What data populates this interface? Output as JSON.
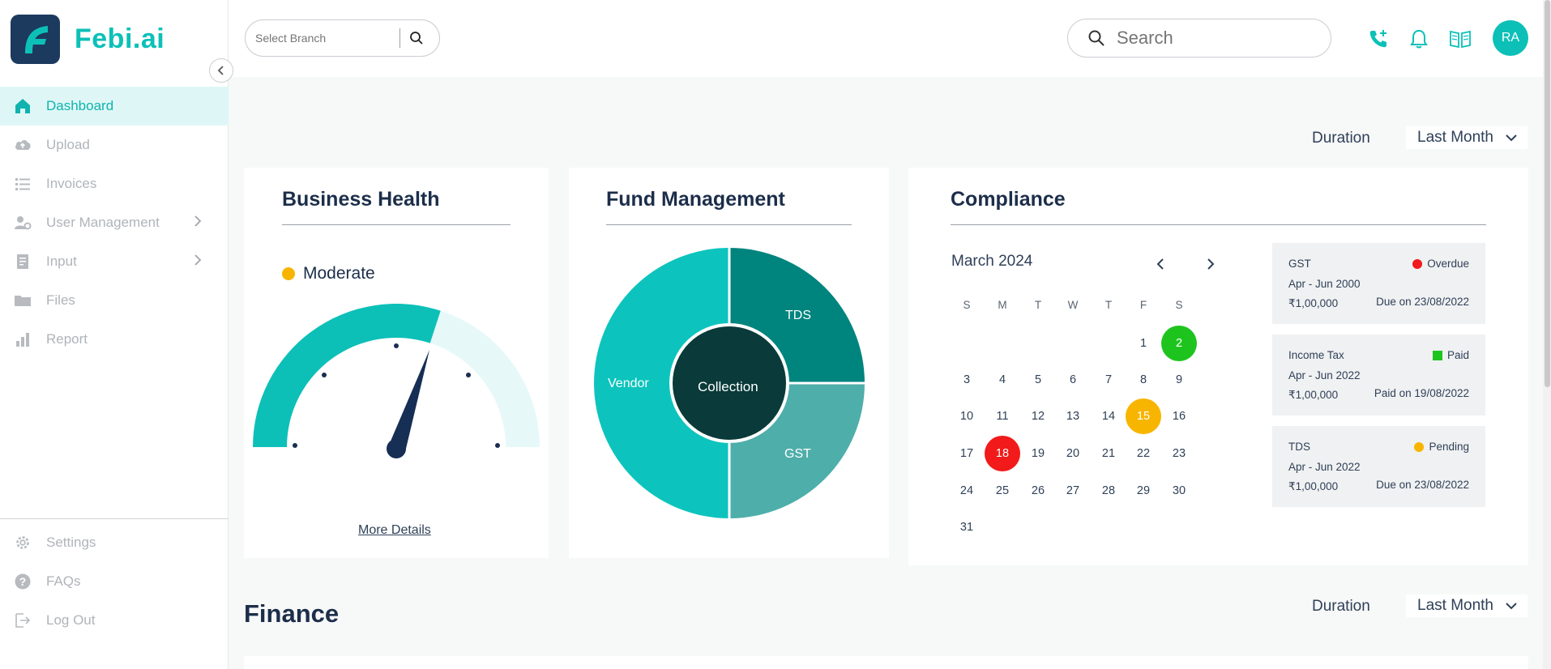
{
  "app": {
    "name": "Febi.ai"
  },
  "sidebar": {
    "items": [
      {
        "label": "Dashboard",
        "icon": "home-icon",
        "active": true
      },
      {
        "label": "Upload",
        "icon": "cloud-upload-icon"
      },
      {
        "label": "Invoices",
        "icon": "list-icon"
      },
      {
        "label": "User Management",
        "icon": "user-settings-icon",
        "submenu": true
      },
      {
        "label": "Input",
        "icon": "document-icon",
        "submenu": true
      },
      {
        "label": "Files",
        "icon": "folder-icon"
      },
      {
        "label": "Report",
        "icon": "bar-chart-icon"
      }
    ],
    "bottom": [
      {
        "label": "Settings",
        "icon": "gear-icon"
      },
      {
        "label": "FAQs",
        "icon": "question-icon"
      },
      {
        "label": "Log Out",
        "icon": "logout-icon"
      }
    ]
  },
  "header": {
    "branch_placeholder": "Select Branch",
    "search_placeholder": "Search",
    "avatar_initials": "RA"
  },
  "filters": {
    "duration_label": "Duration",
    "duration_value": "Last Month"
  },
  "business_health": {
    "title": "Business Health",
    "status": "Moderate",
    "status_color": "#f7b500",
    "link": "More Details"
  },
  "fund_management": {
    "title": "Fund Management",
    "center_label": "Collection",
    "segments": [
      "Vendor",
      "TDS",
      "GST"
    ]
  },
  "compliance": {
    "title": "Compliance",
    "month": "March 2024",
    "weekdays": [
      "S",
      "M",
      "T",
      "W",
      "T",
      "F",
      "S"
    ],
    "highlights": {
      "2": "green",
      "15": "yellow",
      "18": "red"
    },
    "items": [
      {
        "name": "GST",
        "status": "Overdue",
        "status_color": "#f21a1a",
        "period": "Apr - Jun 2000",
        "amount": "₹1,00,000",
        "due": "Due on 23/08/2022"
      },
      {
        "name": "Income Tax",
        "status": "Paid",
        "status_color": "#1ec41e",
        "period": "Apr - Jun 2022",
        "amount": "₹1,00,000",
        "due": "Paid on 19/08/2022"
      },
      {
        "name": "TDS",
        "status": "Pending",
        "status_color": "#f7b500",
        "period": "Apr - Jun 2022",
        "amount": "₹1,00,000",
        "due": "Due on 23/08/2022"
      }
    ]
  },
  "finance": {
    "title": "Finance"
  },
  "colors": {
    "accent": "#0cc0b8",
    "dark_teal": "#0a3a3a",
    "navy": "#1c2e4a"
  }
}
